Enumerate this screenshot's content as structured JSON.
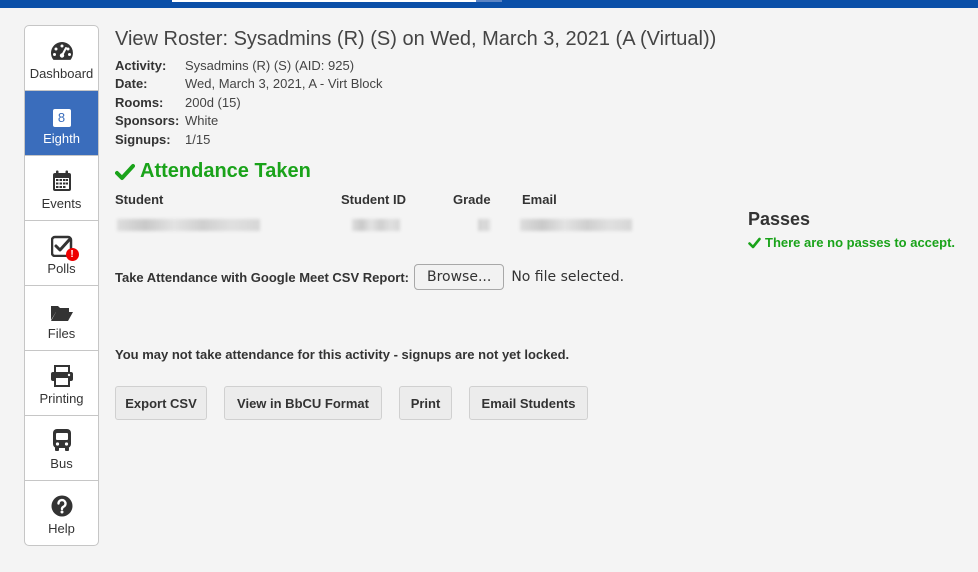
{
  "nav": {
    "items": [
      {
        "label": "Dashboard",
        "icon": "tachometer-icon"
      },
      {
        "label": "Eighth",
        "icon": "eighth-icon",
        "badge": "8"
      },
      {
        "label": "Events",
        "icon": "calendar-icon"
      },
      {
        "label": "Polls",
        "icon": "check-square-icon",
        "badge": "!"
      },
      {
        "label": "Files",
        "icon": "folder-open-icon"
      },
      {
        "label": "Printing",
        "icon": "printer-icon"
      },
      {
        "label": "Bus",
        "icon": "bus-icon"
      },
      {
        "label": "Help",
        "icon": "question-circle-icon"
      }
    ]
  },
  "roster": {
    "title": "View Roster: Sysadmins (R) (S) on Wed, March 3, 2021 (A (Virtual))",
    "details": [
      {
        "key": "Activity:",
        "value": "Sysadmins (R) (S) (AID: 925)"
      },
      {
        "key": "Date:",
        "value": "Wed, March 3, 2021, A - Virt Block"
      },
      {
        "key": "Rooms:",
        "value": "200d (15)"
      },
      {
        "key": "Sponsors:",
        "value": "White"
      },
      {
        "key": "Signups:",
        "value": "1/15"
      }
    ],
    "attendance_status": "Attendance Taken",
    "columns": [
      "Student",
      "Student ID",
      "Grade",
      "Email"
    ]
  },
  "passes": {
    "heading": "Passes",
    "message": "There are no passes to accept."
  },
  "upload": {
    "label": "Take Attendance with Google Meet CSV Report:",
    "button": "Browse...",
    "status": "No file selected."
  },
  "warning": "You may not take attendance for this activity - signups are not yet locked.",
  "actions": {
    "export_csv": "Export CSV",
    "bbcu": "View in BbCU Format",
    "print": "Print",
    "email": "Email Students"
  },
  "colors": {
    "accent": "#3a6dbc",
    "topbar": "#0a4fa8",
    "success": "#1aa31a",
    "badge": "#ee0000"
  }
}
